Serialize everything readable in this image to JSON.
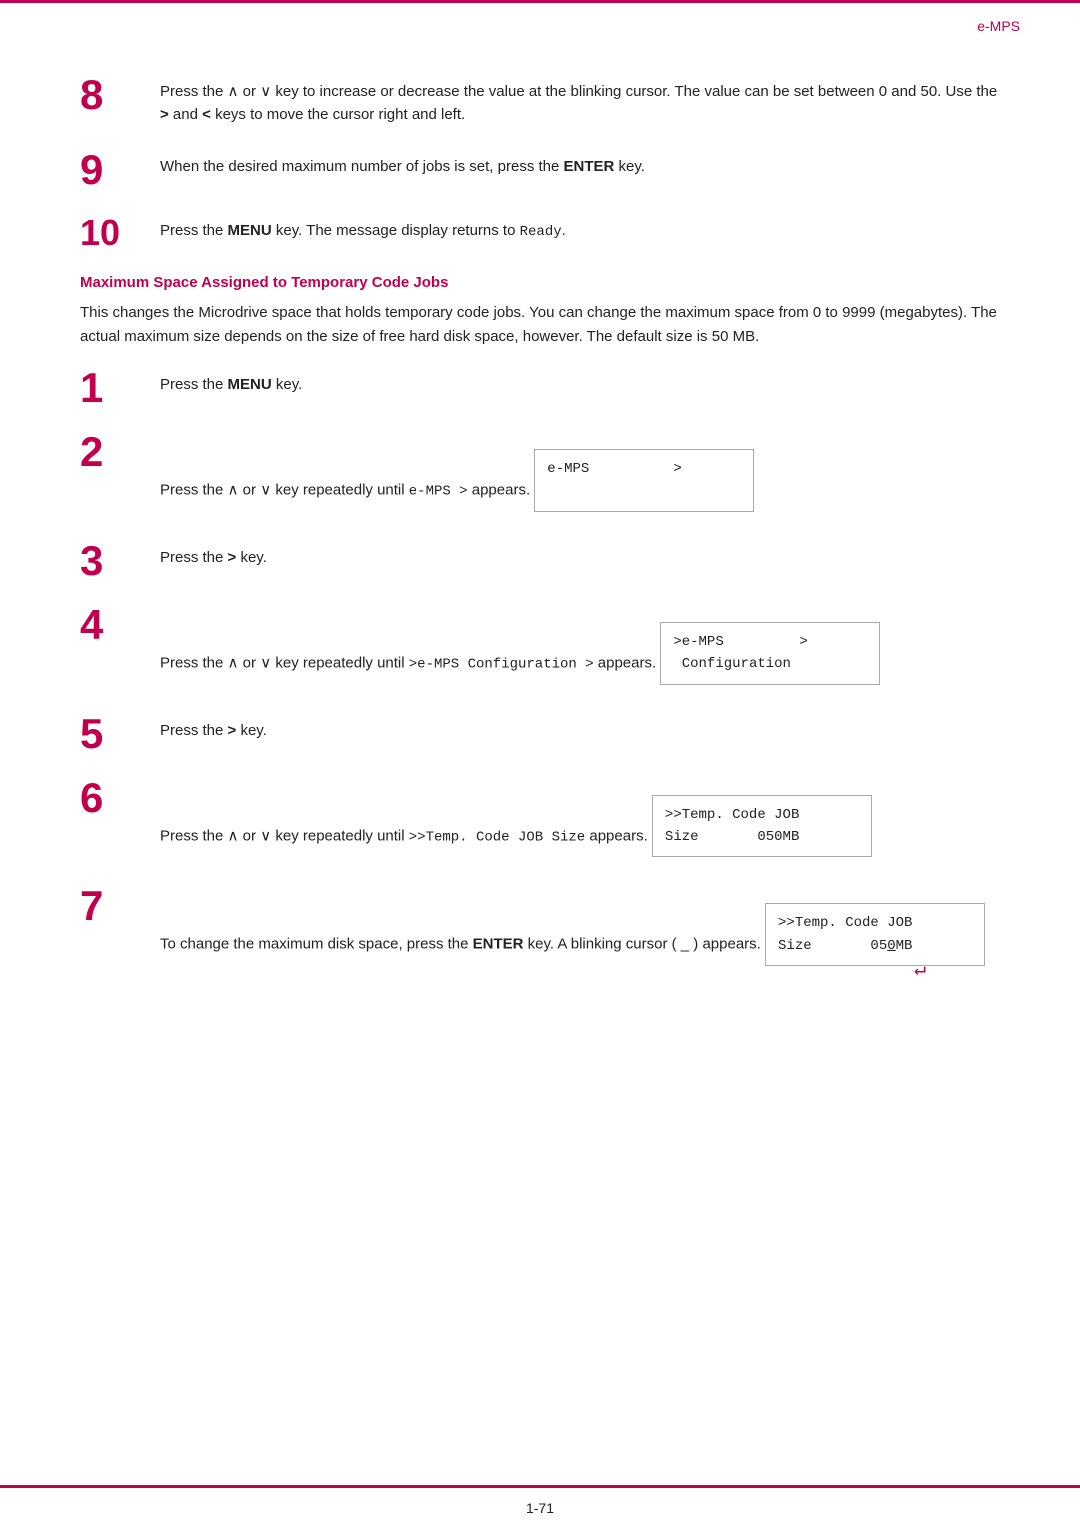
{
  "header": {
    "title": "e-MPS"
  },
  "footer": {
    "page": "1-71"
  },
  "steps_top": [
    {
      "number": "8",
      "text_parts": [
        {
          "type": "text",
          "value": "Press the "
        },
        {
          "type": "sym",
          "value": "∧"
        },
        {
          "type": "text",
          "value": " or "
        },
        {
          "type": "sym",
          "value": "∨"
        },
        {
          "type": "text",
          "value": " key to increase or decrease the value at the blinking cursor. The value can be set between 0 and 50. Use the "
        },
        {
          "type": "bold",
          "value": ">"
        },
        {
          "type": "text",
          "value": " and "
        },
        {
          "type": "bold",
          "value": "<"
        },
        {
          "type": "text",
          "value": " keys to move the cursor right and left."
        }
      ]
    },
    {
      "number": "9",
      "text_parts": [
        {
          "type": "text",
          "value": "When the desired maximum number of jobs is set, press the "
        },
        {
          "type": "bold",
          "value": "ENTER"
        },
        {
          "type": "text",
          "value": " key."
        }
      ]
    },
    {
      "number": "10",
      "text_parts": [
        {
          "type": "text",
          "value": "Press the "
        },
        {
          "type": "bold",
          "value": "MENU"
        },
        {
          "type": "text",
          "value": " key. The message display returns to "
        },
        {
          "type": "mono",
          "value": "Ready"
        },
        {
          "type": "text",
          "value": "."
        }
      ]
    }
  ],
  "section": {
    "heading": "Maximum Space Assigned to Temporary Code Jobs",
    "body": "This changes the Microdrive space that holds temporary code jobs. You can change the maximum space from 0 to 9999 (megabytes). The actual maximum size depends on the size of free hard disk space, however. The default size is 50 MB."
  },
  "steps_bottom": [
    {
      "number": "1",
      "text_parts": [
        {
          "type": "text",
          "value": "Press the "
        },
        {
          "type": "bold",
          "value": "MENU"
        },
        {
          "type": "text",
          "value": " key."
        }
      ],
      "code_box": null
    },
    {
      "number": "2",
      "text_parts": [
        {
          "type": "text",
          "value": "Press the "
        },
        {
          "type": "sym",
          "value": "∧"
        },
        {
          "type": "text",
          "value": " or "
        },
        {
          "type": "sym",
          "value": "∨"
        },
        {
          "type": "text",
          "value": " key repeatedly until "
        },
        {
          "type": "mono",
          "value": "e-MPS  >"
        },
        {
          "type": "text",
          "value": " appears."
        }
      ],
      "code_box": {
        "lines": [
          "e-MPS          >",
          ""
        ]
      }
    },
    {
      "number": "3",
      "text_parts": [
        {
          "type": "text",
          "value": "Press the "
        },
        {
          "type": "bold",
          "value": ">"
        },
        {
          "type": "text",
          "value": " key."
        }
      ],
      "code_box": null
    },
    {
      "number": "4",
      "text_parts": [
        {
          "type": "text",
          "value": "Press the "
        },
        {
          "type": "sym",
          "value": "∧"
        },
        {
          "type": "text",
          "value": " or "
        },
        {
          "type": "sym",
          "value": "∨"
        },
        {
          "type": "text",
          "value": " key repeatedly until "
        },
        {
          "type": "mono",
          "value": ">e-MPS Configuration >"
        },
        {
          "type": "text",
          "value": " appears."
        }
      ],
      "code_box": {
        "lines": [
          ">e-MPS          >",
          " Configuration"
        ]
      }
    },
    {
      "number": "5",
      "text_parts": [
        {
          "type": "text",
          "value": "Press the "
        },
        {
          "type": "bold",
          "value": ">"
        },
        {
          "type": "text",
          "value": " key."
        }
      ],
      "code_box": null
    },
    {
      "number": "6",
      "text_parts": [
        {
          "type": "text",
          "value": "Press the "
        },
        {
          "type": "sym",
          "value": "∧"
        },
        {
          "type": "text",
          "value": " or "
        },
        {
          "type": "sym",
          "value": "∨"
        },
        {
          "type": "text",
          "value": " key repeatedly until "
        },
        {
          "type": "mono",
          "value": ">>Temp. Code JOB Size"
        },
        {
          "type": "text",
          "value": " appears."
        }
      ],
      "code_box": {
        "lines": [
          ">>Temp. Code JOB",
          "Size        050MB"
        ]
      }
    },
    {
      "number": "7",
      "text_parts": [
        {
          "type": "text",
          "value": "To change the maximum disk space, press the "
        },
        {
          "type": "bold",
          "value": "ENTER"
        },
        {
          "type": "text",
          "value": " key. A blinking cursor ( _ ) appears."
        }
      ],
      "code_box": {
        "lines": [
          ">>Temp. Code JOB",
          "Size        050MB"
        ],
        "cursor": true
      }
    }
  ]
}
